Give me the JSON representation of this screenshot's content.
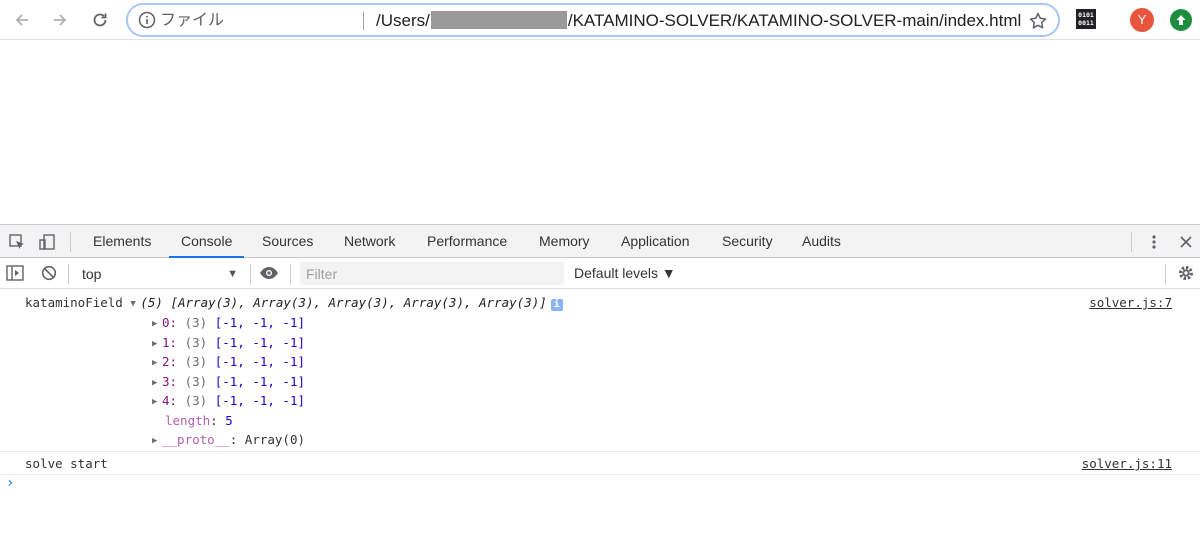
{
  "browser": {
    "omnibox": {
      "scheme_label": "ファイル",
      "url_prefix": "/Users/",
      "url_suffix": "/KATAMINO-SOLVER/KATAMINO-SOLVER-main/index.html"
    },
    "ext_binary_text": "0101\n0011",
    "avatar_letter": "Y"
  },
  "devtools": {
    "tabs": [
      "Elements",
      "Console",
      "Sources",
      "Network",
      "Performance",
      "Memory",
      "Application",
      "Security",
      "Audits"
    ],
    "active_tab": "Console",
    "context": "top",
    "filter_placeholder": "Filter",
    "levels_label": "Default levels ▼"
  },
  "console": {
    "log1": {
      "label": "kataminoField",
      "summary": "(5) [Array(3), Array(3), Array(3), Array(3), Array(3)]",
      "source": "solver.js:7",
      "rows": [
        {
          "key": "0",
          "count": "(3)",
          "values": "[-1, -1, -1]"
        },
        {
          "key": "1",
          "count": "(3)",
          "values": "[-1, -1, -1]"
        },
        {
          "key": "2",
          "count": "(3)",
          "values": "[-1, -1, -1]"
        },
        {
          "key": "3",
          "count": "(3)",
          "values": "[-1, -1, -1]"
        },
        {
          "key": "4",
          "count": "(3)",
          "values": "[-1, -1, -1]"
        }
      ],
      "length_key": "length",
      "length_value": "5",
      "proto_key": "__proto__",
      "proto_value": "Array(0)"
    },
    "log2": {
      "text": "solve start",
      "source": "solver.js:11"
    },
    "prompt": "›"
  },
  "colors": {
    "accent": "#1a73e8",
    "key_purple": "#881280",
    "number_blue": "#1c00cf",
    "avatar_red": "#e8553c",
    "ext_green": "#1e8e3e"
  }
}
